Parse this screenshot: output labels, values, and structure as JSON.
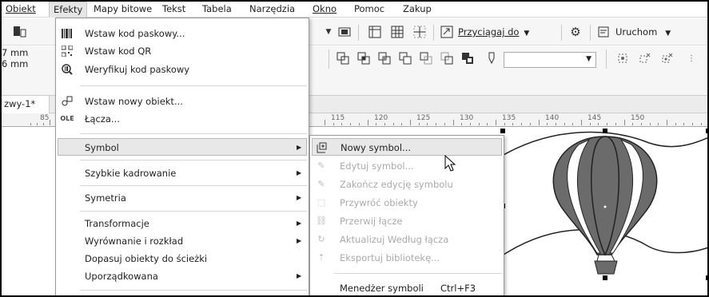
{
  "menubar": {
    "items": [
      "Obiekt",
      "Efekty",
      "Mapy bitowe",
      "Tekst",
      "Tabela",
      "Narzędzia",
      "Okno",
      "Pomoc",
      "Zakup"
    ]
  },
  "toolbar": {
    "snap_label": "Przyciągaj do",
    "launch_label": "Uruchom",
    "dim1": "7 mm",
    "dim2": "6 mm",
    "combo_value": ""
  },
  "document_tab": "zwy-1*",
  "ruler": {
    "left_label": "85",
    "labels": [
      "115",
      "120",
      "125",
      "130",
      "135",
      "140",
      "145",
      "150"
    ]
  },
  "effects_menu": {
    "top_items": [
      {
        "label": "Wstaw kod paskowy...",
        "icon": "barcode-icon"
      },
      {
        "label": "Wstaw kod QR",
        "icon": "qr-code-icon"
      },
      {
        "label": "Weryfikuj kod paskowy",
        "icon": "verify-barcode-icon"
      },
      {
        "label": "Wstaw nowy obiekt...",
        "icon": "insert-object-icon"
      },
      {
        "label": "Łącza...",
        "icon": "ole-links-icon"
      }
    ],
    "symbol": "Symbol",
    "quick_crop": "Szybkie kadrowanie",
    "symmetry": "Symetria",
    "transformations": "Transformacje",
    "align": "Wyrównanie i rozkład",
    "fit_path": "Dopasuj obiekty do ścieżki",
    "order": "Uporządkowana"
  },
  "symbol_menu": {
    "new_symbol": "Nowy symbol...",
    "edit_symbol": "Edytuj symbol...",
    "finish_edit": "Zakończ edycję symbolu",
    "restore": "Przywróć obiekty",
    "break_link": "Przerwij łącze",
    "update": "Aktualizuj Według łącza",
    "export": "Eksportuj bibliotekę...",
    "manager": "Menedżer symboli",
    "manager_shortcut": "Ctrl+F3"
  },
  "colors": {
    "balloon_fill": "#6b6b6b",
    "menu_highlight": "#e8e8e8"
  }
}
